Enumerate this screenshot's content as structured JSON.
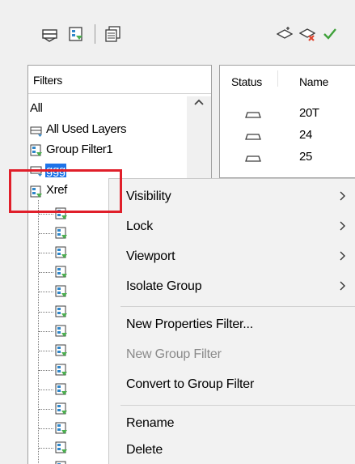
{
  "toolbar": {
    "left_icons": [
      "new-properties-filter-icon",
      "new-group-filter-icon",
      "layer-states-manager-icon"
    ],
    "right_icons": [
      "new-layer-icon",
      "delete-layer-icon",
      "set-current-check-icon"
    ],
    "colors": {
      "delete_x": "#e0452f",
      "check": "#3fa13a"
    }
  },
  "filters_panel": {
    "header": "Filters",
    "tree": {
      "root": "All",
      "items": [
        {
          "label": "All Used Layers",
          "icon": "used-layers-filter-icon"
        },
        {
          "label": "Group Filter1",
          "icon": "group-filter-icon"
        },
        {
          "label": "ggg",
          "icon": "properties-filter-icon",
          "selected": true
        },
        {
          "label": "Xref",
          "icon": "xref-filter-icon"
        }
      ],
      "child_icon": "group-filter-icon",
      "child_count": 14
    }
  },
  "layers_panel": {
    "columns": [
      "Status",
      "Name"
    ],
    "rows": [
      {
        "status_icon": "layer-status-icon",
        "name": "20T"
      },
      {
        "status_icon": "layer-status-icon",
        "name": "24"
      },
      {
        "status_icon": "layer-status-icon",
        "name": "25"
      }
    ]
  },
  "context_menu": {
    "groups": [
      [
        {
          "label": "Visibility",
          "submenu": true
        },
        {
          "label": "Lock",
          "submenu": true
        },
        {
          "label": "Viewport",
          "submenu": true
        },
        {
          "label": "Isolate Group",
          "submenu": true
        }
      ],
      [
        {
          "label": "New Properties Filter...",
          "submenu": false
        },
        {
          "label": "New Group Filter",
          "submenu": false,
          "disabled": true
        },
        {
          "label": "Convert to Group Filter",
          "submenu": false
        }
      ],
      [
        {
          "label": "Rename",
          "submenu": false
        },
        {
          "label": "Delete",
          "submenu": false
        }
      ]
    ]
  },
  "annotation": {
    "highlight_color": "#e01f2a",
    "selection_color": "#1e73e8"
  }
}
